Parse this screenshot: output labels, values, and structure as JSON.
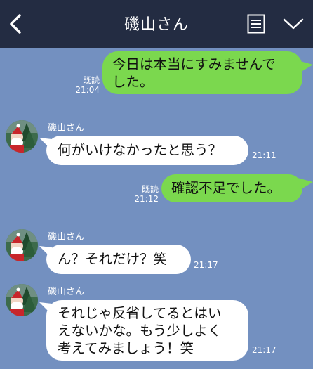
{
  "header": {
    "title": "磯山さん",
    "back_icon": "chevron-left-icon",
    "menu_icon": "list-icon",
    "collapse_icon": "chevron-down-icon"
  },
  "colors": {
    "background": "#7390c0",
    "header": "#232c42",
    "outgoing_bubble": "#7bd84e",
    "incoming_bubble": "#ffffff"
  },
  "messages": [
    {
      "direction": "out",
      "text_lines": [
        "今日は本当にすみませんで",
        "した。"
      ],
      "read_label": "既読",
      "time": "21:04"
    },
    {
      "direction": "in",
      "sender": "磯山さん",
      "text_lines": [
        "何がいけなかったと思う？"
      ],
      "time": "21:11"
    },
    {
      "direction": "out",
      "text_lines": [
        "確認不足でした。"
      ],
      "read_label": "既読",
      "time": "21:12"
    },
    {
      "direction": "in",
      "sender": "磯山さん",
      "text_lines": [
        "ん？それだけ？笑"
      ],
      "time": "21:17"
    },
    {
      "direction": "in",
      "sender": "磯山さん",
      "text_lines": [
        "それじゃ反省してるとはい",
        "えないかな。もう少しよく",
        "考えてみましょう！笑"
      ],
      "time": "21:17"
    }
  ]
}
